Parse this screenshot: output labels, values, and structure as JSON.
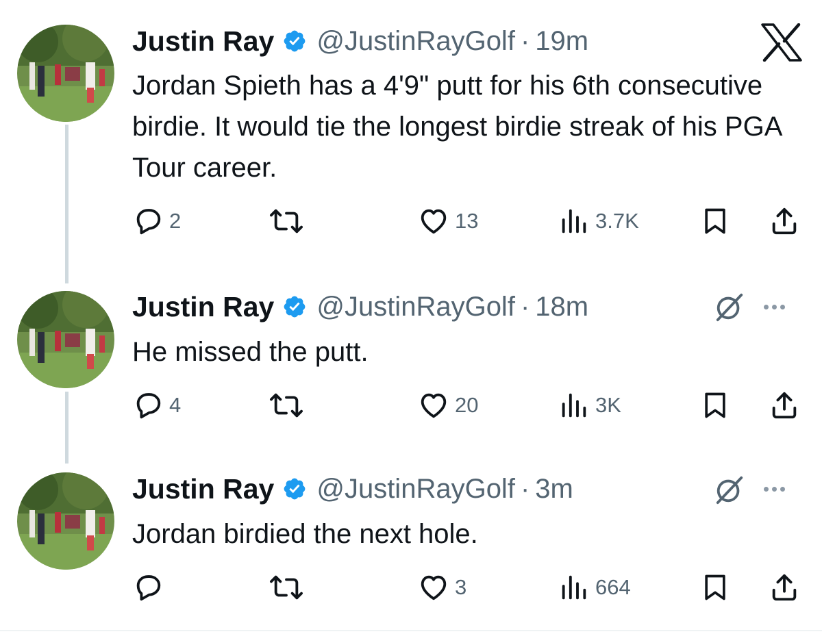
{
  "colors": {
    "verified_badge": "#1d9bf0",
    "secondary_text": "#536471",
    "thread_line": "#cfd9de"
  },
  "header": {
    "logo_icon": "x-logo-icon"
  },
  "tweets": [
    {
      "author_name": "Justin Ray",
      "handle": "@JustinRayGolf",
      "separator": "·",
      "time": "19m",
      "text": "Jordan Spieth has a 4'9\" putt for his 6th consecutive birdie. It would tie the longest birdie streak of his PGA Tour career.",
      "replies": "2",
      "reposts": "",
      "likes": "13",
      "views": "3.7K"
    },
    {
      "author_name": "Justin Ray",
      "handle": "@JustinRayGolf",
      "separator": "·",
      "time": "18m",
      "text": "He missed the putt.",
      "replies": "4",
      "reposts": "",
      "likes": "20",
      "views": "3K"
    },
    {
      "author_name": "Justin Ray",
      "handle": "@JustinRayGolf",
      "separator": "·",
      "time": "3m",
      "text": "Jordan birdied the next hole.",
      "replies": "",
      "reposts": "",
      "likes": "3",
      "views": "664"
    }
  ]
}
